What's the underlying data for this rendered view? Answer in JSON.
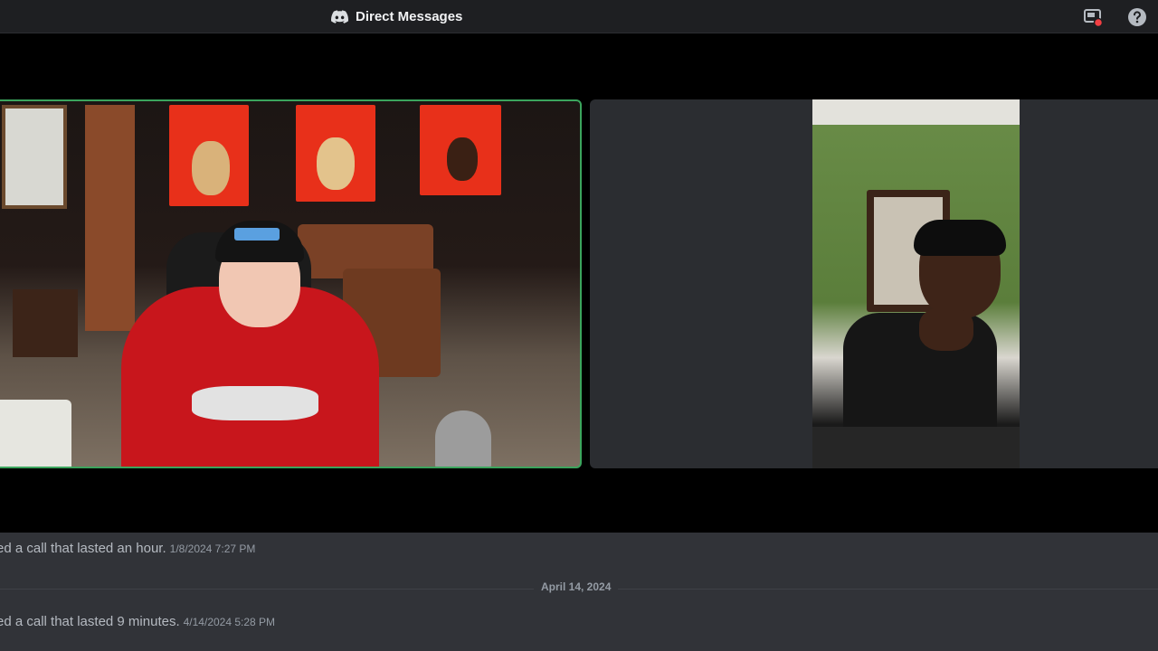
{
  "titlebar": {
    "title": "Direct Messages",
    "icons": [
      "discord-logo-icon",
      "screen-share-icon",
      "help-icon"
    ]
  },
  "call": {
    "participants": [
      {
        "speaking": true,
        "outline_color": "#3ba55d"
      },
      {
        "speaking": false
      }
    ]
  },
  "chat": {
    "messages": [
      {
        "text": "ed a call that lasted an hour.",
        "timestamp": "1/8/2024 7:27 PM"
      },
      {
        "text": "ed a call that lasted 9 minutes.",
        "timestamp": "4/14/2024 5:28 PM"
      }
    ],
    "date_divider": "April 14, 2024"
  },
  "colors": {
    "titlebar_bg": "#1e1f22",
    "call_bg": "#000000",
    "chat_bg": "#313338",
    "speaking_outline": "#3ba55d",
    "notification_dot": "#f23f43"
  }
}
